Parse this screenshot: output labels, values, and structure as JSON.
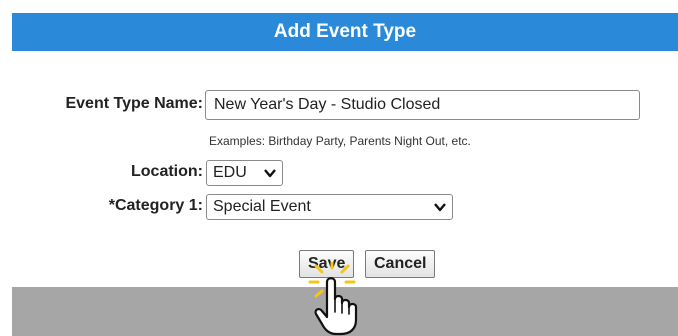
{
  "dialog": {
    "title": "Add Event Type"
  },
  "form": {
    "event_type_name_label": "Event Type Name:",
    "event_type_name_value": "New Year's Day - Studio Closed",
    "examples_hint": "Examples: Birthday Party, Parents Night Out, etc.",
    "location_label": "Location:",
    "location_value": "EDU",
    "category1_label": "*Category 1:",
    "category1_value": "Special Event"
  },
  "actions": {
    "save_label": "Save",
    "cancel_label": "Cancel"
  },
  "colors": {
    "header_bg": "#2a8ad9",
    "footer_bg": "#a6a6a6",
    "click_highlight": "#f5c518"
  },
  "icons": {
    "select_arrow": "chevron-down-icon",
    "cursor": "hand-pointer-icon"
  }
}
